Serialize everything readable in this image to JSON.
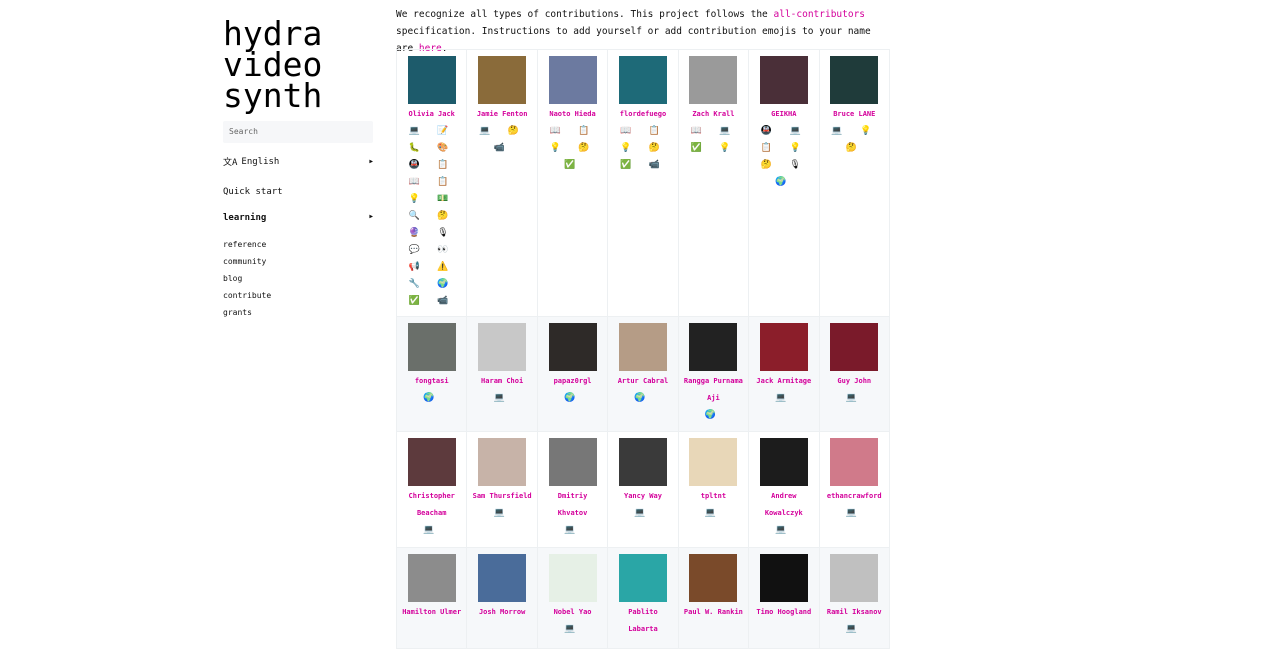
{
  "sidebar": {
    "logo": [
      "hydra",
      "video",
      "synth"
    ],
    "search_placeholder": "Search",
    "language": "English",
    "quick_start": "Quick start",
    "learning": "learning",
    "links": [
      "reference",
      "community",
      "blog",
      "contribute",
      "grants"
    ]
  },
  "intro": {
    "p1": "We recognize all types of contributions. This project follows the ",
    "link1": "all-contributors",
    "p2": " specification. Instructions to add yourself or add contribution emojis to your name are ",
    "link2": "here",
    "p3": "."
  },
  "contributors": [
    [
      {
        "name": "Olivia Jack",
        "emojis": [
          "💻 📝",
          "🐛 🎨",
          "🚇 📋",
          "📖 📋",
          "💡 💵",
          "🔍 🤔",
          "🔮 🎙",
          "💬 👀",
          "📢 ⚠️",
          "🔧 🌍",
          "✅ 📹"
        ],
        "color": "#1d5b6b"
      },
      {
        "name": "Jamie Fenton",
        "emojis": [
          "💻 🤔",
          "📹"
        ],
        "color": "#8a6b3a"
      },
      {
        "name": "Naoto Hieda",
        "emojis": [
          "📖 📋",
          "💡 🤔",
          "✅"
        ],
        "color": "#6c7aa0"
      },
      {
        "name": "flordefuego",
        "emojis": [
          "📖 📋",
          "💡 🤔",
          "✅ 📹"
        ],
        "color": "#1e6a78"
      },
      {
        "name": "Zach Krall",
        "emojis": [
          "📖 💻",
          "✅ 💡"
        ],
        "color": "#9a9a9a"
      },
      {
        "name": "GEIKHA",
        "emojis": [
          "🚇 💻",
          "📋 💡",
          "🤔 🎙",
          "🌍"
        ],
        "color": "#4a2f38"
      },
      {
        "name": "Bruce LANE",
        "emojis": [
          "💻 💡 🤔"
        ],
        "color": "#1f3b3a"
      }
    ],
    [
      {
        "name": "fongtasi",
        "emojis": [
          "🌍"
        ],
        "color": "#6a6f6a"
      },
      {
        "name": "Haram Choi",
        "emojis": [
          "💻"
        ],
        "color": "#c8c8c8"
      },
      {
        "name": "papaz0rgl",
        "emojis": [
          "🌍"
        ],
        "color": "#2e2a28"
      },
      {
        "name": "Artur Cabral",
        "emojis": [
          "🌍"
        ],
        "color": "#b59c86"
      },
      {
        "name": "Rangga Purnama Aji",
        "emojis": [
          "🌍"
        ],
        "color": "#222222"
      },
      {
        "name": "Jack Armitage",
        "emojis": [
          "💻"
        ],
        "color": "#8b1e2a"
      },
      {
        "name": "Guy John",
        "emojis": [
          "💻"
        ],
        "color": "#7a1a2a"
      }
    ],
    [
      {
        "name": "Christopher Beacham",
        "emojis": [
          "💻"
        ],
        "color": "#5d3a3d"
      },
      {
        "name": "Sam Thursfield",
        "emojis": [
          "💻"
        ],
        "color": "#c7b3a8"
      },
      {
        "name": "Dmitriy Khvatov",
        "emojis": [
          "💻"
        ],
        "color": "#777777"
      },
      {
        "name": "Yancy Way",
        "emojis": [
          "💻"
        ],
        "color": "#3a3a3a"
      },
      {
        "name": "tpltnt",
        "emojis": [
          "💻"
        ],
        "color": "#e8d7b8"
      },
      {
        "name": "Andrew Kowalczyk",
        "emojis": [
          "💻"
        ],
        "color": "#1c1c1c"
      },
      {
        "name": "ethancrawford",
        "emojis": [
          "💻"
        ],
        "color": "#d07a8a"
      }
    ],
    [
      {
        "name": "Hamilton Ulmer",
        "emojis": [],
        "color": "#8c8c8c"
      },
      {
        "name": "Josh Morrow",
        "emojis": [],
        "color": "#4a6c9a"
      },
      {
        "name": "Nobel Yao",
        "emojis": [
          "💻"
        ],
        "color": "#e6f0e6"
      },
      {
        "name": "Pablito Labarta",
        "emojis": [],
        "color": "#2aa6a6"
      },
      {
        "name": "Paul W. Rankin",
        "emojis": [],
        "color": "#7a4a2a"
      },
      {
        "name": "Timo Hoogland",
        "emojis": [],
        "color": "#111111"
      },
      {
        "name": "Ramil Iksanov",
        "emojis": [
          "💻"
        ],
        "color": "#c0c0c0"
      }
    ]
  ],
  "colors": {
    "accent": "#d4009b",
    "border": "#edf0f2",
    "rowAlt": "#f6f8fa"
  }
}
